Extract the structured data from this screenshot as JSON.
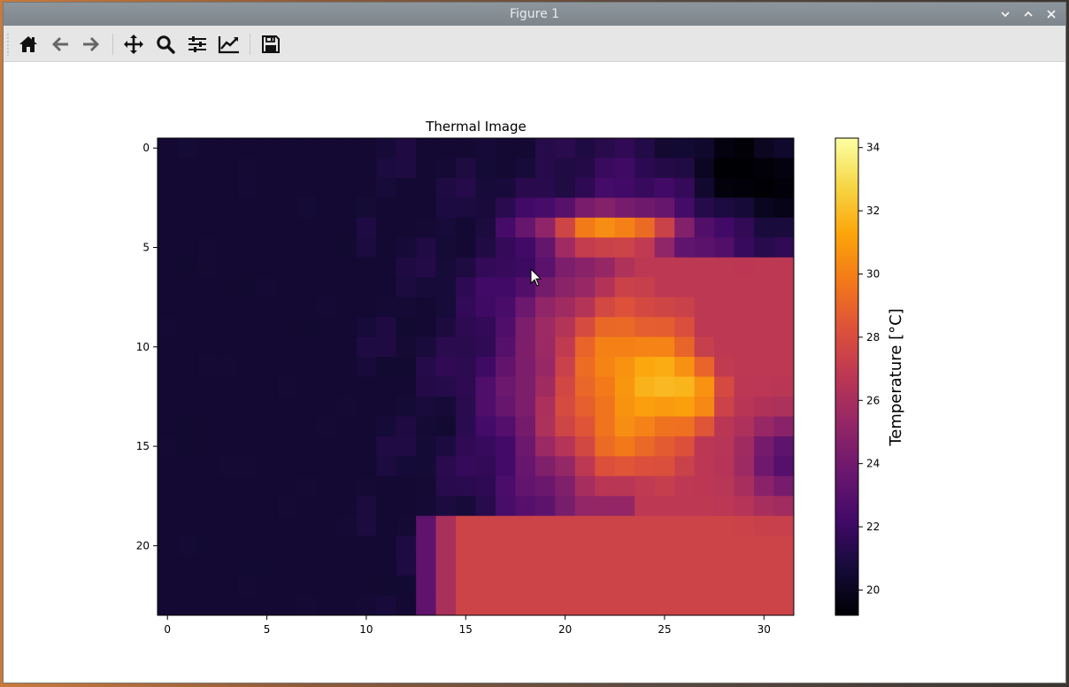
{
  "window": {
    "title": "Figure 1"
  },
  "toolbar": {
    "icons": [
      "home-icon",
      "back-arrow-icon",
      "forward-arrow-icon",
      "pan-icon",
      "zoom-icon",
      "subplots-configure-icon",
      "edit-axis-icon",
      "save-icon"
    ]
  },
  "chart_data": {
    "type": "heatmap",
    "title": "Thermal Image",
    "xlabel": "",
    "ylabel": "",
    "x_ticks": [
      "0",
      "5",
      "10",
      "15",
      "20",
      "25",
      "30"
    ],
    "y_ticks": [
      "0",
      "5",
      "10",
      "15",
      "20"
    ],
    "xlim": [
      -0.5,
      31.5
    ],
    "ylim": [
      23.5,
      -0.5
    ],
    "grid_cols": 32,
    "grid_rows": 24,
    "colormap": "inferno",
    "colorbar": {
      "label": "Temperature [°C]",
      "ticks": [
        "20",
        "22",
        "24",
        "26",
        "28",
        "30",
        "32",
        "34"
      ],
      "vmin": 19.2,
      "vmax": 34.3
    },
    "grid_visible": false,
    "legend": "none",
    "description_regions": {
      "background_cold_c": 20.5,
      "head_region_c": 31,
      "hotspot_c": 34,
      "body_lower_c": 27.5
    }
  }
}
